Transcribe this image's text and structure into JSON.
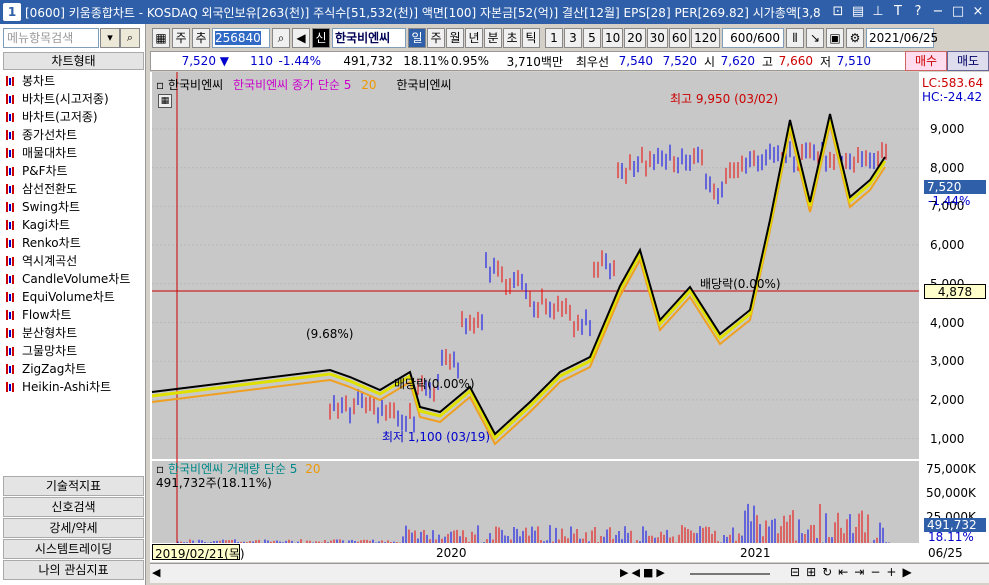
{
  "titlebar": {
    "number": "1",
    "title": "[0600] 키움종합차트 - KOSDAQ 외국인보유[263(천)] 주식수[51,532(천)] 액면[100] 자본금[52(억)] 결산[12월] EPS[28] PER[269.82] 시가총액[3,8"
  },
  "sidebar": {
    "search_placeholder": "메뉴항목검색",
    "header": "차트형태",
    "items": [
      "봉차트",
      "바차트(시고저종)",
      "바차트(고저종)",
      "종가선차트",
      "매물대차트",
      "P&F차트",
      "삼선전환도",
      "Swing차트",
      "Kagi차트",
      "Renko차트",
      "역시계곡선",
      "CandleVolume차트",
      "EquiVolume차트",
      "Flow차트",
      "분산형차트",
      "그물망차트",
      "ZigZag차트",
      "Heikin-Ashi차트"
    ],
    "bottom": [
      "기술적지표",
      "신호검색",
      "강세/약세",
      "시스템트레이딩",
      "나의 관심지표"
    ]
  },
  "toolbar": {
    "type1": "주",
    "add": "추",
    "code": "256840",
    "name": "한국비엔씨",
    "badge": "신",
    "periods": [
      "일",
      "주",
      "월",
      "년",
      "분",
      "초",
      "틱"
    ],
    "nums": [
      "1",
      "3",
      "5",
      "10",
      "20",
      "30",
      "60",
      "120"
    ],
    "count": "600/600",
    "date": "2021/06/25"
  },
  "quote": {
    "price": "7,520 ▼",
    "change": "110",
    "pct": "-1.44%",
    "volume": "491,732",
    "vol_ratio": "18.11%",
    "r2": "0.95%",
    "amount": "3,710백만",
    "best_label": "최우선",
    "bid": "7,540",
    "ask": "7,520",
    "open_label": "시",
    "open": "7,620",
    "high_label": "고",
    "high": "7,660",
    "low_label": "저",
    "low": "7,510",
    "buy": "매수",
    "sell": "매도"
  },
  "chart": {
    "legend_name": "한국비엔씨",
    "legend_ma": "한국비엔씨 종가 단순 5",
    "legend_ma2": "20",
    "legend_name2": "한국비엔씨",
    "lc": "LC:583.64",
    "hc": "HC:-24.42",
    "price_axis": [
      "9,000",
      "8,000",
      "7,000",
      "6,000",
      "5,000",
      "4,000",
      "3,000",
      "2,000",
      "1,000"
    ],
    "cur_price": "7,520",
    "cur_pct": "-1.44%",
    "cross": "4,878",
    "ann_high": "최고 9,950 (03/02)",
    "ann_low": "최저 1,100 (03/19)",
    "ann_div1": "배당락(0.00%)",
    "ann_div2": "배당락(0.00%)",
    "ann_968": "(9.68%)",
    "vol_legend": "한국비엔씨 거래량 단순 5",
    "vol_legend2": "20",
    "vol_value": "491,732주(18.11%)",
    "vol_axis": [
      "75,000K",
      "50,000K",
      "25,000K"
    ],
    "vol_cur": "491,732",
    "vol_pct": "18.11%",
    "x_start": "2019/02/21(목)",
    "x_labels": [
      "2020",
      "2021"
    ],
    "x_end": "06/25"
  }
}
